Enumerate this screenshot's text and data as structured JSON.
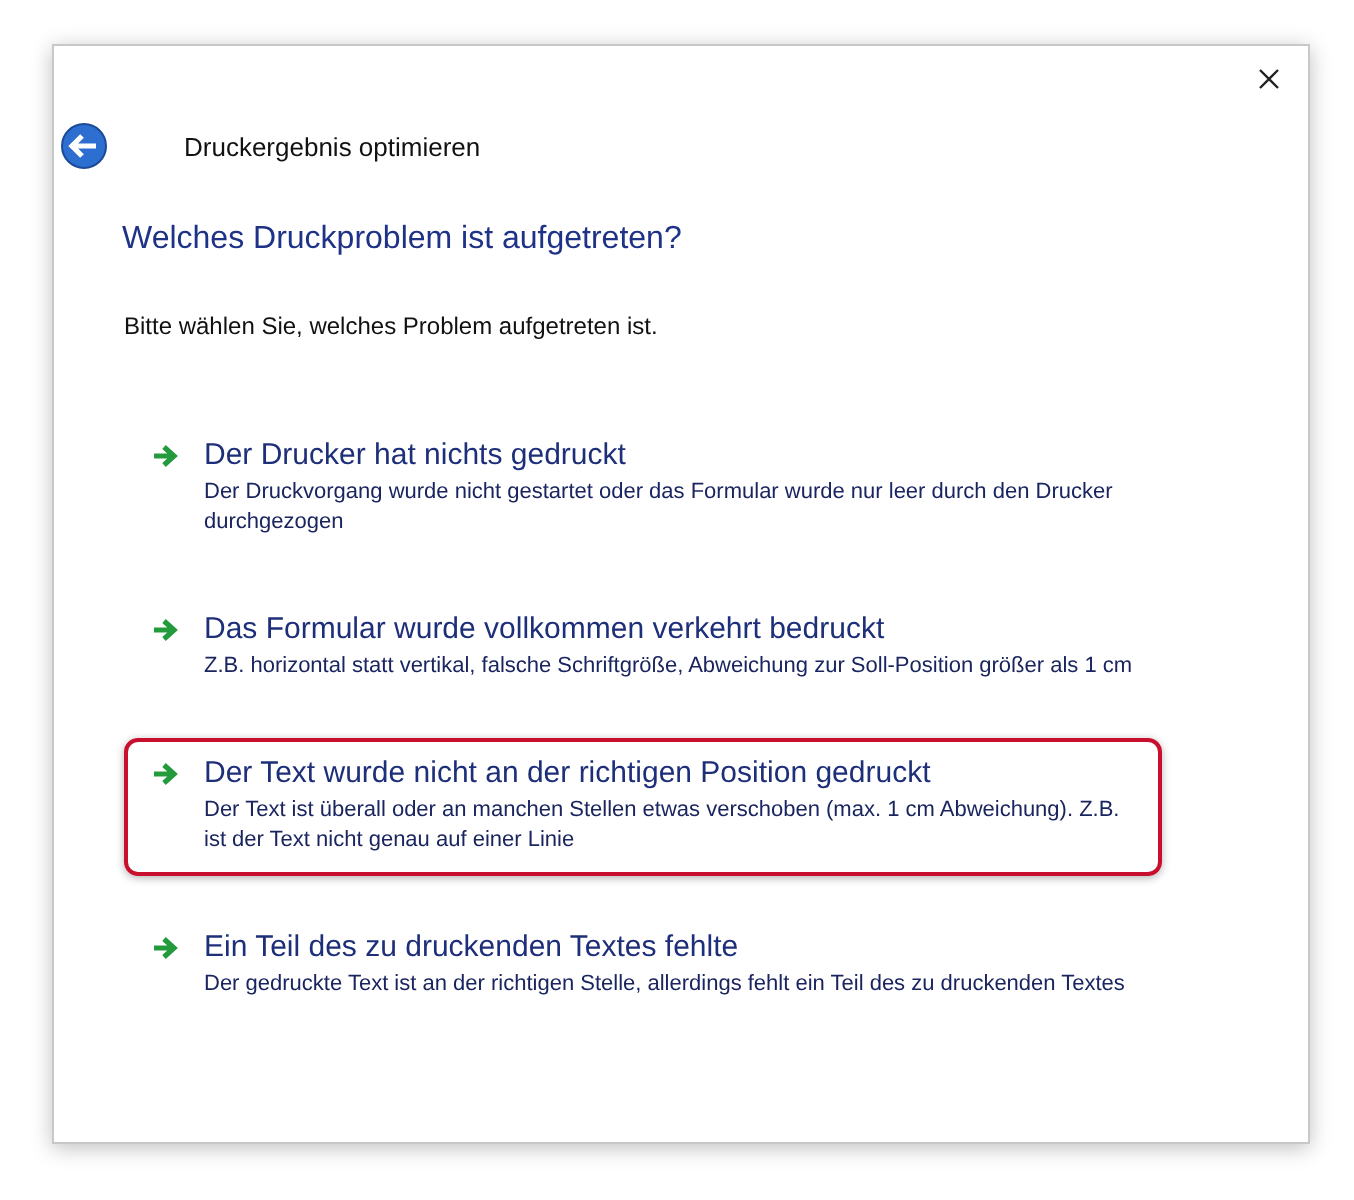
{
  "window": {
    "title": "Druckergebnis optimieren"
  },
  "heading": "Welches Druckproblem ist aufgetreten?",
  "instruction": "Bitte wählen Sie, welches Problem aufgetreten ist.",
  "options": [
    {
      "title": "Der Drucker hat nichts gedruckt",
      "description": "Der Druckvorgang wurde nicht gestartet oder das Formular wurde nur leer durch den Drucker durchgezogen",
      "highlighted": false
    },
    {
      "title": "Das Formular wurde vollkommen verkehrt bedruckt",
      "description": "Z.B. horizontal statt vertikal, falsche Schriftgröße, Abweichung zur Soll-Position größer als 1 cm",
      "highlighted": false
    },
    {
      "title": "Der Text wurde nicht an der richtigen Position gedruckt",
      "description": "Der Text ist überall oder an manchen Stellen etwas verschoben (max. 1 cm Abweichung). Z.B. ist der Text nicht genau auf einer Linie",
      "highlighted": true
    },
    {
      "title": "Ein Teil des zu druckenden Textes fehlte",
      "description": "Der gedruckte Text ist an der richtigen Stelle, allerdings fehlt ein Teil des zu druckenden Textes",
      "highlighted": false
    }
  ]
}
